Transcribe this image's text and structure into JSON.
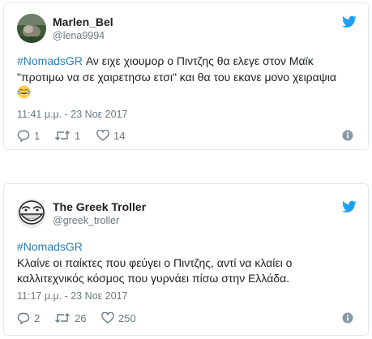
{
  "colors": {
    "accent": "#1da1f2",
    "hashtag": "#2b7bb9",
    "muted": "#697882",
    "text": "#1c2022",
    "border": "#e1e8ed"
  },
  "tweets": [
    {
      "name": "Marlen_Bel",
      "handle": "@lena9994",
      "hashtag": "#NomadsGR",
      "text_line1": "Αν ειχε χιουμορ ο Πιντζης θα ελεγε στον Μαϊκ",
      "text_line2": "\"προτιμω να σε χαιρετησω ετσι\" και θα του εκανε μονο χειραψια",
      "emoji": "face-with-tears-of-joy",
      "timestamp": "11:41 μ.μ. - 23 Νοε 2017",
      "replies": "1",
      "retweets": "1",
      "likes": "14"
    },
    {
      "name": "The Greek Troller",
      "handle": "@greek_troller",
      "hashtag": "#NomadsGR",
      "text_line1": "Κλαίνε οι παίκτες που φεύγει ο Πιντζης, αντί να κλαίει ο",
      "text_line2": "καλλιτεχνικός κόσμος που γυρνάει πίσω στην Ελλάδα.",
      "timestamp": "11:17 μ.μ. - 23 Νοε 2017",
      "replies": "2",
      "retweets": "26",
      "likes": "250"
    }
  ]
}
